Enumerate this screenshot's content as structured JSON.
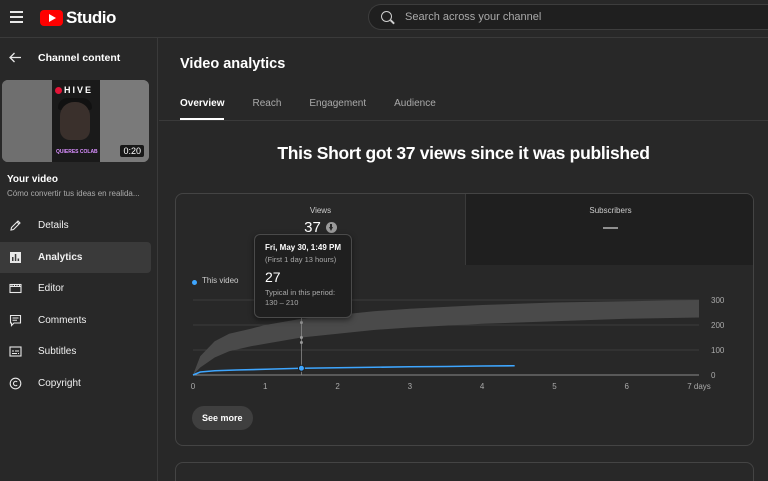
{
  "app": {
    "logo_text": "Studio",
    "brand_color": "#ff0000"
  },
  "search": {
    "placeholder": "Search across your channel"
  },
  "sidebar": {
    "back_title": "Channel content",
    "thumbnail": {
      "brand": "HIVE",
      "caption": "QUIERES COLAB",
      "duration": "0:20"
    },
    "your_video_label": "Your video",
    "video_description": "Cómo convertir tus ideas en realida...",
    "items": [
      {
        "label": "Details",
        "icon": "pencil-icon",
        "active": false
      },
      {
        "label": "Analytics",
        "icon": "analytics-icon",
        "active": true
      },
      {
        "label": "Editor",
        "icon": "film-editor-icon",
        "active": false
      },
      {
        "label": "Comments",
        "icon": "comments-icon",
        "active": false
      },
      {
        "label": "Subtitles",
        "icon": "subtitles-icon",
        "active": false
      },
      {
        "label": "Copyright",
        "icon": "copyright-icon",
        "active": false
      }
    ]
  },
  "main": {
    "title": "Video analytics",
    "tabs": [
      {
        "label": "Overview",
        "active": true
      },
      {
        "label": "Reach",
        "active": false
      },
      {
        "label": "Engagement",
        "active": false
      },
      {
        "label": "Audience",
        "active": false
      }
    ],
    "headline": "This Short got 37 views since it was published",
    "metrics": {
      "views": {
        "label": "Views",
        "value": "37",
        "trend_icon": "down-arrow-icon"
      },
      "subscribers": {
        "label": "Subscribers",
        "value": "—"
      }
    },
    "legend_label": "This video",
    "see_more_label": "See more",
    "tooltip": {
      "date": "Fri, May 30, 1:49 PM",
      "period": "(First 1 day 13 hours)",
      "value": "27",
      "typical_label": "Typical in this period:",
      "typical_range": "130 – 210"
    }
  },
  "chart_data": {
    "type": "line",
    "x_label_ticks": [
      "0",
      "1",
      "2",
      "3",
      "4",
      "5",
      "6",
      "7 days"
    ],
    "x_ticks": [
      0,
      1,
      2,
      3,
      4,
      5,
      6,
      7
    ],
    "y_ticks": [
      0,
      100,
      200,
      300
    ],
    "xlim": [
      0,
      7
    ],
    "ylim": [
      0,
      300
    ],
    "grid": true,
    "series": [
      {
        "name": "This video",
        "color": "#3ea6ff",
        "x": [
          0,
          0.1,
          0.3,
          0.6,
          1.0,
          1.5,
          2.0,
          2.5,
          3.0,
          3.5,
          4.0,
          4.45
        ],
        "y": [
          0,
          12,
          17,
          20,
          23,
          27,
          29,
          31,
          33,
          34,
          36,
          37
        ]
      }
    ],
    "typical_band": {
      "color": "#4a4a4a",
      "x": [
        0,
        0.1,
        0.3,
        0.5,
        0.8,
        1.0,
        1.2,
        1.5,
        2.0,
        2.5,
        3.0,
        4.0,
        5.0,
        6.0,
        7.0
      ],
      "low": [
        0,
        30,
        70,
        95,
        115,
        125,
        135,
        150,
        165,
        180,
        190,
        205,
        215,
        225,
        230
      ],
      "high": [
        0,
        75,
        135,
        165,
        185,
        200,
        210,
        225,
        240,
        255,
        265,
        280,
        290,
        295,
        300
      ]
    },
    "hover": {
      "x": 1.5,
      "y": 27
    }
  }
}
